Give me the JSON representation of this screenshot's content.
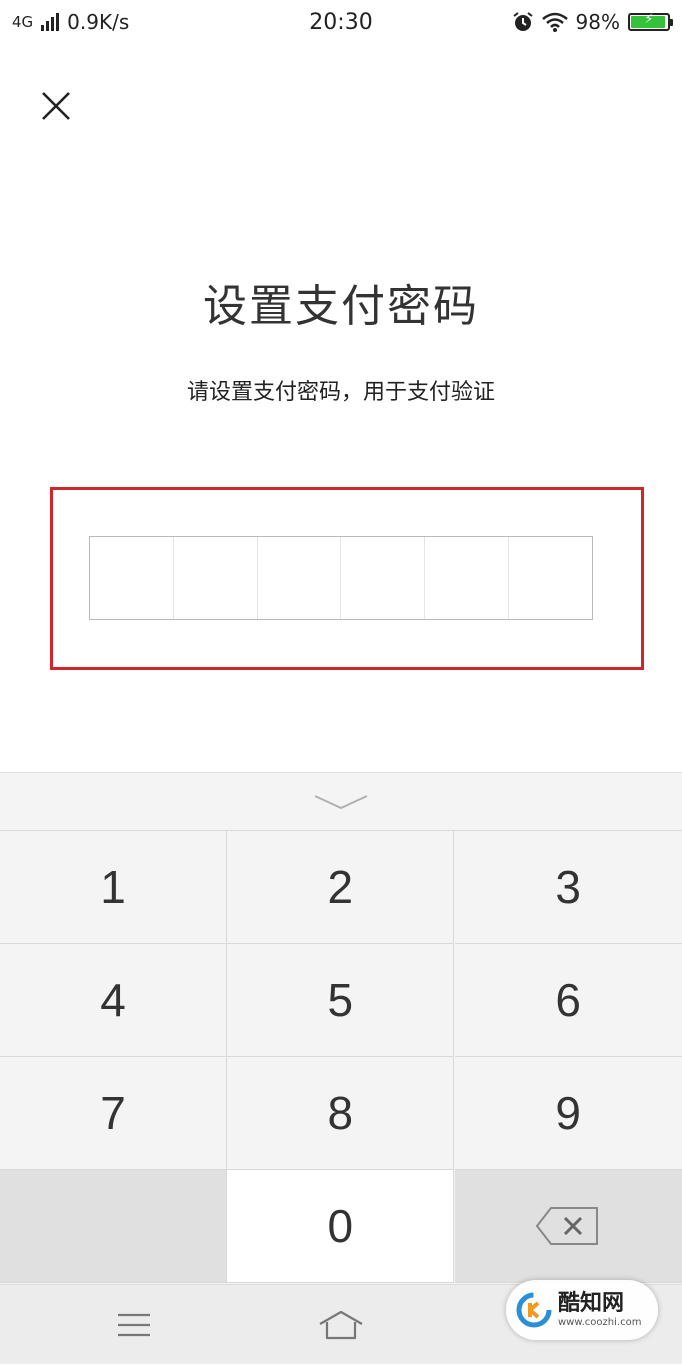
{
  "status_bar": {
    "network": "4G",
    "speed": "0.9K/s",
    "time": "20:30",
    "battery": "98%",
    "battery_level": 0.98
  },
  "header": {
    "close_icon": "close-icon"
  },
  "main": {
    "title": "设置支付密码",
    "subtitle": "请设置支付密码，用于支付验证",
    "pin_length": 6,
    "highlight_color": "#d0262b"
  },
  "keyboard": {
    "collapse_icon": "chevron-down-icon",
    "keys": [
      "1",
      "2",
      "3",
      "4",
      "5",
      "6",
      "7",
      "8",
      "9",
      "",
      "0",
      "backspace"
    ],
    "backspace_icon": "backspace-icon"
  },
  "nav_bar": {
    "menu_icon": "menu-icon",
    "home_icon": "home-icon"
  },
  "watermark": {
    "name": "酷知网",
    "url": "www.coozhi.com"
  }
}
